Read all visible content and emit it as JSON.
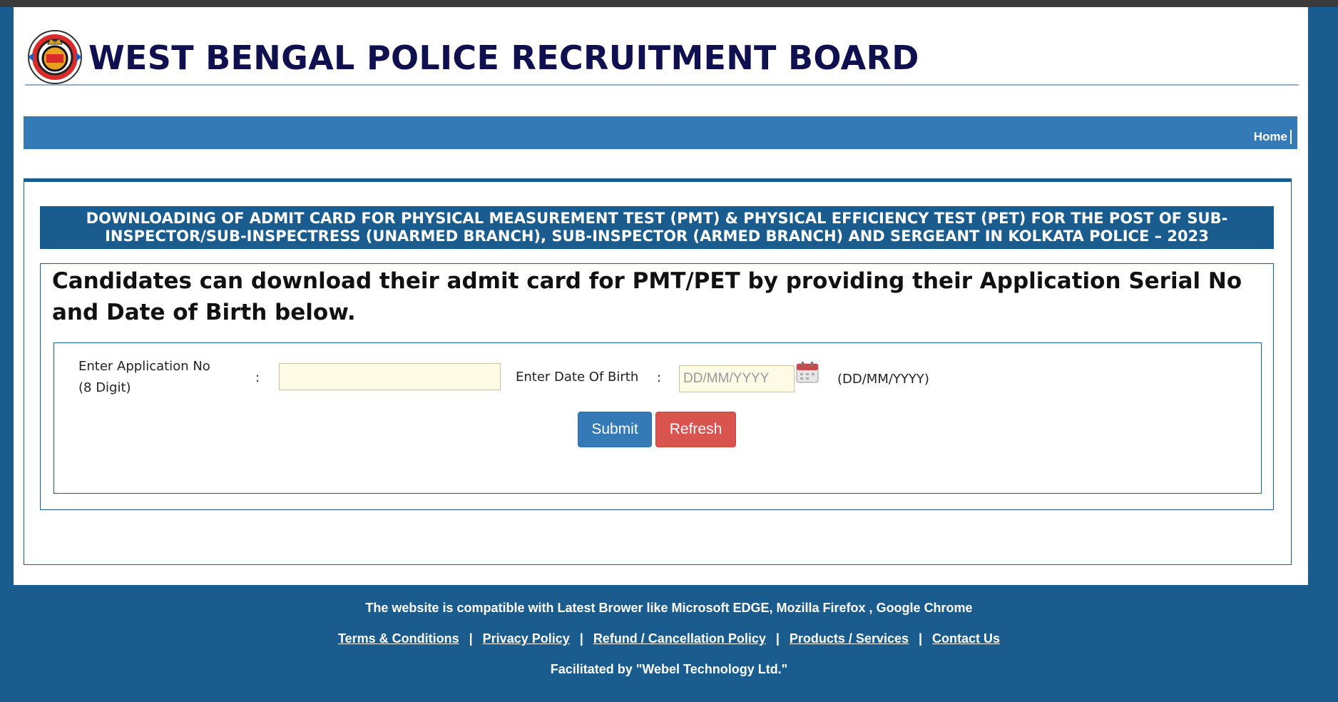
{
  "header": {
    "title": "WEST BENGAL POLICE RECRUITMENT BOARD",
    "logo_text": "WEST BENGAL POLICE"
  },
  "nav": {
    "home": "Home"
  },
  "notice": {
    "line1": "DOWNLOADING OF ADMIT CARD FOR PHYSICAL MEASUREMENT TEST (PMT) & PHYSICAL EFFICIENCY TEST (PET) FOR THE POST OF SUB-",
    "line2": "INSPECTOR/SUB-INSPECTRESS (UNARMED BRANCH), SUB-INSPECTOR (ARMED BRANCH) AND SERGEANT IN KOLKATA POLICE – 2023"
  },
  "info": {
    "text": "Candidates can download their admit card for PMT/PET by providing their Application Serial No and Date of Birth below."
  },
  "form": {
    "app_label_line1": "Enter Application No",
    "app_label_line2": "(8 Digit)",
    "colon": ":",
    "app_value": "",
    "dob_label": "Enter Date Of Birth",
    "dob_placeholder": "DD/MM/YYYY",
    "dob_hint": "(DD/MM/YYYY)",
    "submit": "Submit",
    "refresh": "Refresh"
  },
  "footer": {
    "compat": "The website is compatible with Latest Brower like Microsoft EDGE, Mozilla Firefox , Google Chrome",
    "links": [
      "Terms & Conditions",
      "Privacy Policy",
      "Refund / Cancellation Policy",
      "Products / Services",
      "Contact Us"
    ],
    "separator": "|",
    "credit": "Facilitated by \"Webel Technology Ltd.\""
  },
  "colors": {
    "brand_blue": "#1b5c8f",
    "nav_blue": "#337ab7",
    "title_navy": "#101050",
    "refresh_red": "#d9534f",
    "input_bg": "#fdfbe6"
  },
  "icons": {
    "logo": "police-emblem",
    "calendar": "calendar-icon"
  }
}
